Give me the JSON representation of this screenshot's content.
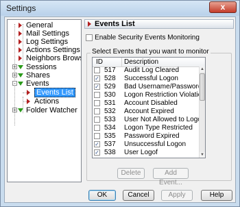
{
  "window": {
    "title": "Settings",
    "close_symbol": "x"
  },
  "tree": {
    "items": [
      {
        "label": "General",
        "icon": "red-triangle"
      },
      {
        "label": "Mail Settings",
        "icon": "red-triangle"
      },
      {
        "label": "Log Settings",
        "icon": "red-triangle"
      },
      {
        "label": "Actions Settings",
        "icon": "red-triangle"
      },
      {
        "label": "Neighbors Browser",
        "icon": "red-triangle"
      },
      {
        "label": "Sessions",
        "icon": "green-triangle",
        "expander": "+"
      },
      {
        "label": "Shares",
        "icon": "green-triangle",
        "expander": "+"
      },
      {
        "label": "Events",
        "icon": "green-triangle",
        "expander": "-"
      },
      {
        "label": "Events List",
        "icon": "red-triangle",
        "selected": true
      },
      {
        "label": "Actions",
        "icon": "red-triangle"
      },
      {
        "label": "Folder Watcher",
        "icon": "green-triangle",
        "expander": "+"
      }
    ]
  },
  "panel": {
    "title": "Events List",
    "enable_label": "Enable Security Events Monitoring",
    "enable_checked": false,
    "group_label": "Select Events that you want to monitor",
    "columns": [
      "ID",
      "Description"
    ],
    "rows": [
      {
        "id": "517",
        "desc": "Audit Log Cleared",
        "checked": false
      },
      {
        "id": "528",
        "desc": "Successful Logon",
        "checked": true
      },
      {
        "id": "529",
        "desc": "Bad Username/Password",
        "checked": true
      },
      {
        "id": "530",
        "desc": "Logon Restriction Violation",
        "checked": false
      },
      {
        "id": "531",
        "desc": "Account Disabled",
        "checked": false
      },
      {
        "id": "532",
        "desc": "Account Expired",
        "checked": false
      },
      {
        "id": "533",
        "desc": "User Not Allowed to Logon",
        "checked": false
      },
      {
        "id": "534",
        "desc": "Logon Type Restricted",
        "checked": false
      },
      {
        "id": "535",
        "desc": "Password Expired",
        "checked": false
      },
      {
        "id": "537",
        "desc": "Unsuccessful Logon",
        "checked": true
      },
      {
        "id": "538",
        "desc": "User Logof",
        "checked": true
      }
    ],
    "delete_label": "Delete",
    "add_event_label": "Add Event..."
  },
  "footer": {
    "ok": "OK",
    "cancel": "Cancel",
    "apply": "Apply",
    "help": "Help"
  },
  "colors": {
    "accent": "#3399ff",
    "tree_red": "#b32020",
    "tree_green": "#2a9a1a",
    "close_red": "#c43b2a"
  }
}
